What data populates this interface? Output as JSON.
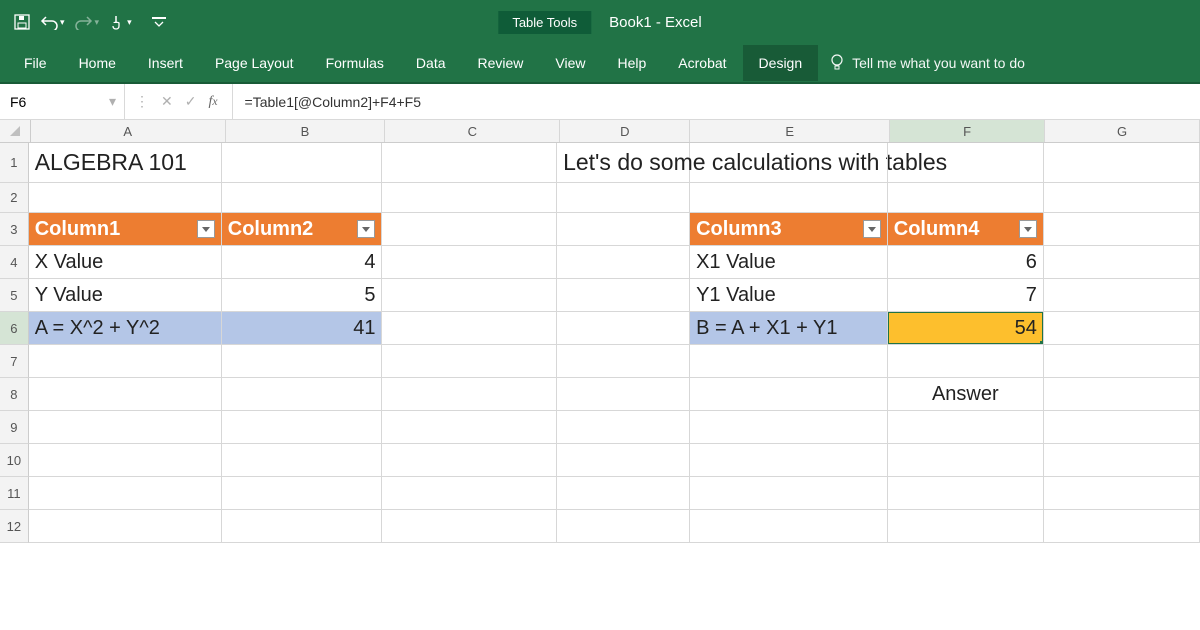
{
  "title": {
    "tabtools": "Table Tools",
    "filename": "Book1  -  Excel"
  },
  "qat": {
    "save": "save-icon",
    "undo": "undo-icon",
    "redo": "redo-icon",
    "touch": "touch-mode-icon"
  },
  "ribbon": {
    "tabs": [
      "File",
      "Home",
      "Insert",
      "Page Layout",
      "Formulas",
      "Data",
      "Review",
      "View",
      "Help",
      "Acrobat",
      "Design"
    ],
    "active": "Design",
    "tell": "Tell me what you want to do"
  },
  "namebox": "F6",
  "formula": "=Table1[@Column2]+F4+F5",
  "columns": [
    "A",
    "B",
    "C",
    "D",
    "E",
    "F",
    "G"
  ],
  "rows": [
    "1",
    "2",
    "3",
    "4",
    "5",
    "6",
    "7",
    "8",
    "9",
    "10",
    "11",
    "12"
  ],
  "cells": {
    "A1": "ALGEBRA 101",
    "D1": "Let's do some calculations with tables",
    "A3": "Column1",
    "B3": "Column2",
    "A4": "X Value",
    "B4": "4",
    "A5": "Y Value",
    "B5": "5",
    "A6": "A = X^2 + Y^2",
    "B6": "41",
    "E3": "Column3",
    "F3": "Column4",
    "E4": "X1 Value",
    "F4": "6",
    "E5": "Y1 Value",
    "F5": "7",
    "E6": "B = A + X1 + Y1",
    "F6": "54",
    "F8": "Answer"
  }
}
